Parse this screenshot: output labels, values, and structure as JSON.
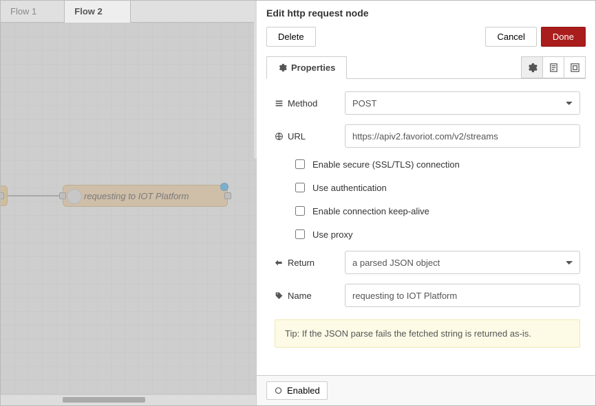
{
  "tabs": [
    "Flow 1",
    "Flow 2"
  ],
  "active_tab_index": 1,
  "canvas_node_label": "requesting to IOT Platform",
  "panel_title": "Edit http request node",
  "buttons": {
    "delete": "Delete",
    "cancel": "Cancel",
    "done": "Done"
  },
  "properties_tab": "Properties",
  "form": {
    "method_label": "Method",
    "method_value": "POST",
    "url_label": "URL",
    "url_value": "https://apiv2.favoriot.com/v2/streams",
    "ssl_label": "Enable secure (SSL/TLS) connection",
    "auth_label": "Use authentication",
    "keepalive_label": "Enable connection keep-alive",
    "proxy_label": "Use proxy",
    "return_label": "Return",
    "return_value": "a parsed JSON object",
    "name_label": "Name",
    "name_value": "requesting to IOT Platform"
  },
  "tip": "Tip: If the JSON parse fails the fetched string is returned as-is.",
  "footer_enabled": "Enabled"
}
